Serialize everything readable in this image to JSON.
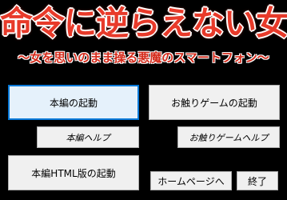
{
  "header": {
    "title": "命令に逆らえない女",
    "subtitle": "～女を思いのまま操る悪魔のスマートフォン～"
  },
  "buttons": {
    "main_start": "本編の起動",
    "touch_game_start": "お触りゲームの起動",
    "main_help": "本編ヘルプ",
    "touch_game_help": "お触りゲームヘルプ",
    "html_start": "本編HTML版の起動",
    "homepage": "ホームページへ",
    "exit": "終了"
  },
  "colors": {
    "background": "#000000",
    "title_red": "#e83a2a",
    "button_face": "#f0f0f0",
    "focus_border": "#0078d7"
  }
}
